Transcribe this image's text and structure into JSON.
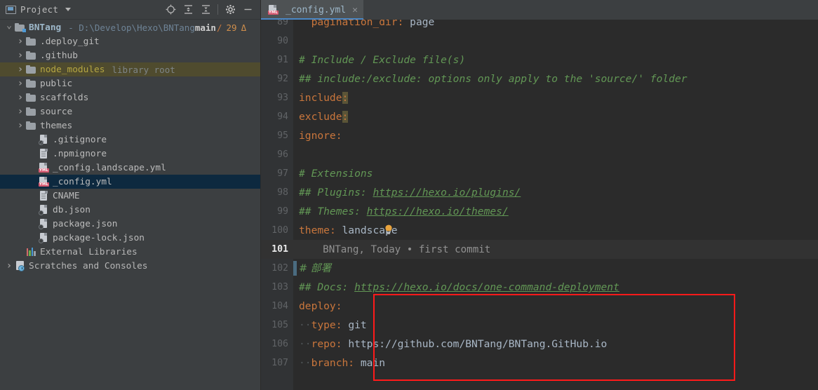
{
  "window": {
    "app": "IntelliJ IDEA / Hexo project"
  },
  "sidebar": {
    "title": "Project",
    "title_icon": "project-panel-icon",
    "caret_icon": "chevron-down-icon",
    "toolbar": [
      {
        "name": "select-opened-file-icon",
        "label": "Select Opened File"
      },
      {
        "name": "expand-all-icon",
        "label": "Expand All"
      },
      {
        "name": "collapse-all-icon",
        "label": "Collapse All"
      },
      {
        "name": "gear-icon",
        "label": "Settings"
      },
      {
        "name": "minimize-icon",
        "label": "Hide"
      }
    ],
    "root": {
      "name": "BNTang",
      "dash": "-",
      "path": "D:\\Develop\\Hexo\\BNTang",
      "branch": "main",
      "slash": "/",
      "count": "29",
      "triangle": "Δ",
      "expanded": true
    },
    "items": [
      {
        "label": ".deploy_git",
        "icon": "folder-icon",
        "expandable": true,
        "indent": 2,
        "style": "folder",
        "suffix": ""
      },
      {
        "label": ".github",
        "icon": "folder-icon",
        "expandable": true,
        "indent": 2,
        "style": "folder",
        "suffix": ""
      },
      {
        "label": "node_modules",
        "icon": "folder-icon",
        "expandable": true,
        "indent": 2,
        "style": "library",
        "suffix": "library root",
        "highlight": true
      },
      {
        "label": "public",
        "icon": "folder-icon",
        "expandable": true,
        "indent": 2,
        "style": "folder",
        "suffix": ""
      },
      {
        "label": "scaffolds",
        "icon": "folder-icon",
        "expandable": true,
        "indent": 2,
        "style": "folder",
        "suffix": ""
      },
      {
        "label": "source",
        "icon": "folder-icon",
        "expandable": true,
        "indent": 2,
        "style": "folder",
        "suffix": ""
      },
      {
        "label": "themes",
        "icon": "folder-icon",
        "expandable": true,
        "indent": 2,
        "style": "folder",
        "suffix": ""
      },
      {
        "label": ".gitignore",
        "icon": "gitignore-file-icon",
        "expandable": false,
        "indent": 3,
        "style": "file",
        "suffix": ""
      },
      {
        "label": ".npmignore",
        "icon": "text-file-icon",
        "expandable": false,
        "indent": 3,
        "style": "file",
        "suffix": ""
      },
      {
        "label": "_config.landscape.yml",
        "icon": "yaml-file-icon",
        "expandable": false,
        "indent": 3,
        "style": "file",
        "suffix": ""
      },
      {
        "label": "_config.yml",
        "icon": "yaml-file-icon",
        "expandable": false,
        "indent": 3,
        "style": "file",
        "suffix": "",
        "selected": true
      },
      {
        "label": "CNAME",
        "icon": "text-file-icon",
        "expandable": false,
        "indent": 3,
        "style": "file",
        "suffix": ""
      },
      {
        "label": "db.json",
        "icon": "json-file-icon",
        "expandable": false,
        "indent": 3,
        "style": "file",
        "suffix": ""
      },
      {
        "label": "package.json",
        "icon": "json-file-icon",
        "expandable": false,
        "indent": 3,
        "style": "file",
        "suffix": ""
      },
      {
        "label": "package-lock.json",
        "icon": "json-file-icon",
        "expandable": false,
        "indent": 3,
        "style": "file",
        "suffix": ""
      },
      {
        "label": "External Libraries",
        "icon": "libraries-icon",
        "expandable": false,
        "indent": 2,
        "style": "plain",
        "suffix": ""
      },
      {
        "label": "Scratches and Consoles",
        "icon": "scratches-icon",
        "expandable": true,
        "indent": 1,
        "style": "plain",
        "suffix": ""
      }
    ]
  },
  "editor": {
    "tab": {
      "label": "_config.yml",
      "icon": "yaml-file-icon",
      "close_icon": "close-icon",
      "active": true
    },
    "current_line": 101,
    "blame_annotation": "BNTang, Today • first commit",
    "inspection_icon": "lightbulb-icon",
    "lines": [
      {
        "n": 89,
        "segments": [
          {
            "t": "  pagination_dir",
            "c": "k"
          },
          {
            "t": ":",
            "c": "k"
          },
          {
            "t": " page",
            "c": "v"
          }
        ]
      },
      {
        "n": 90,
        "segments": []
      },
      {
        "n": 91,
        "segments": [
          {
            "t": "# Include / Exclude file(s)",
            "c": "cm"
          }
        ]
      },
      {
        "n": 92,
        "segments": [
          {
            "t": "## include:/exclude: options only apply to the 'source/' folder",
            "c": "cm"
          }
        ]
      },
      {
        "n": 93,
        "segments": [
          {
            "t": "include",
            "c": "k"
          },
          {
            "t": ":",
            "c": "colon-hl"
          }
        ]
      },
      {
        "n": 94,
        "segments": [
          {
            "t": "exclude",
            "c": "k"
          },
          {
            "t": ":",
            "c": "colon-hl"
          }
        ]
      },
      {
        "n": 95,
        "segments": [
          {
            "t": "ignore",
            "c": "k"
          },
          {
            "t": ":",
            "c": "k"
          }
        ]
      },
      {
        "n": 96,
        "segments": []
      },
      {
        "n": 97,
        "segments": [
          {
            "t": "# Extensions",
            "c": "cm"
          }
        ]
      },
      {
        "n": 98,
        "segments": [
          {
            "t": "## Plugins: ",
            "c": "cm"
          },
          {
            "t": "https://hexo.io/plugins/",
            "c": "lnk"
          }
        ]
      },
      {
        "n": 99,
        "segments": [
          {
            "t": "## Themes: ",
            "c": "cm"
          },
          {
            "t": "https://hexo.io/themes/",
            "c": "lnk"
          }
        ]
      },
      {
        "n": 100,
        "segments": [
          {
            "t": "theme",
            "c": "k"
          },
          {
            "t": ":",
            "c": "k"
          },
          {
            "t": " landscape",
            "c": "v"
          }
        ]
      },
      {
        "n": 101,
        "segments": [],
        "blame": true,
        "current": true
      },
      {
        "n": 102,
        "segments": [
          {
            "t": "# 部署",
            "c": "cjk"
          }
        ],
        "change_marker": true
      },
      {
        "n": 103,
        "segments": [
          {
            "t": "## Docs: ",
            "c": "cm"
          },
          {
            "t": "https://hexo.io/docs/one-command-deployment",
            "c": "lnk"
          }
        ]
      },
      {
        "n": 104,
        "segments": [
          {
            "t": "deploy",
            "c": "k"
          },
          {
            "t": ":",
            "c": "k"
          }
        ]
      },
      {
        "n": 105,
        "segments": [
          {
            "t": "··",
            "c": "dot"
          },
          {
            "t": "type",
            "c": "k"
          },
          {
            "t": ":",
            "c": "k"
          },
          {
            "t": " git",
            "c": "v"
          }
        ]
      },
      {
        "n": 106,
        "segments": [
          {
            "t": "··",
            "c": "dot"
          },
          {
            "t": "repo",
            "c": "k"
          },
          {
            "t": ":",
            "c": "k"
          },
          {
            "t": " https://github.com/BNTang/BNTang.GitHub.io",
            "c": "v"
          }
        ]
      },
      {
        "n": 107,
        "segments": [
          {
            "t": "··",
            "c": "dot"
          },
          {
            "t": "branch",
            "c": "k"
          },
          {
            "t": ":",
            "c": "k"
          },
          {
            "t": " main",
            "c": "v"
          }
        ]
      }
    ],
    "annotation_box": {
      "color": "#ff1a1a",
      "covers_lines": [
        104,
        107
      ],
      "name": "deploy-config-highlight-box"
    }
  },
  "colors": {
    "sidebar_bg": "#3c3f41",
    "editor_bg": "#2b2b2b",
    "gutter_bg": "#313335",
    "selection_bg": "#0d293f",
    "library_highlight_bg": "#4f4b2e",
    "accent_blue": "#4a88c7",
    "key_orange": "#c9763c",
    "comment_green": "#629755",
    "value_grey": "#a9b7c6",
    "annotation_red": "#ff1a1a"
  }
}
